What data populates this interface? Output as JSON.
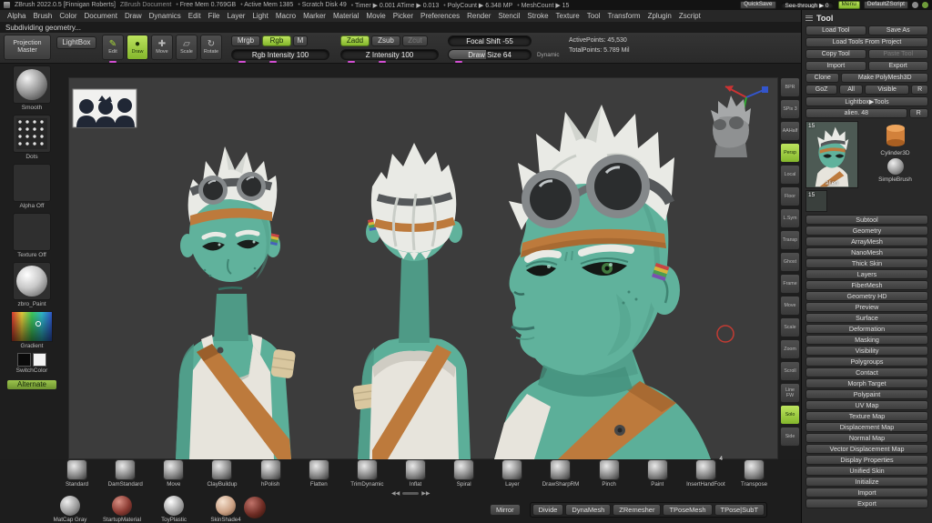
{
  "colors": {
    "accent_green": "#a6d83c",
    "skin_teal": "#60b29c",
    "hair_white": "#e9eae5",
    "strap_orange": "#bd7a3c",
    "canvas_gray": "#3c3c3c"
  },
  "title_bar": {
    "app_title": "ZBrush 2022.0.5 [Finnigan Roberts]",
    "doc_title": "ZBrush Document",
    "stats": [
      "Free Mem 0.769GB",
      "Active Mem 1385",
      "Scratch Disk 49",
      "Timer ▶ 0.001 ATime ▶ 0.013",
      "PolyCount ▶ 6.348 MP",
      "MeshCount ▶ 15"
    ],
    "quicksave": "QuickSave",
    "see_through": "See-through ▶ 0",
    "menu_button": "Menu",
    "zscript_button": "DefaultZScript"
  },
  "menubar": {
    "items": [
      "Alpha",
      "Brush",
      "Color",
      "Document",
      "Draw",
      "Dynamics",
      "Edit",
      "File",
      "Layer",
      "Light",
      "Macro",
      "Marker",
      "Material",
      "Movie",
      "Picker",
      "Preferences",
      "Render",
      "Stencil",
      "Stroke",
      "Texture",
      "Tool",
      "Transform",
      "Zplugin",
      "Zscript"
    ]
  },
  "status": {
    "message": "Subdividing geometry..."
  },
  "top_shelf": {
    "projection_master": "Projection Master",
    "lightbox": "LightBox",
    "edit": "Edit",
    "draw": "Draw",
    "move": "Move",
    "scale": "Scale",
    "rotate": "Rotate",
    "mrgb": "Mrgb",
    "rgb": "Rgb",
    "m": "M",
    "rgb_intensity": "Rgb Intensity 100",
    "zadd": "Zadd",
    "zsub": "Zsub",
    "zcut": "Zcut",
    "z_intensity": "Z Intensity 100",
    "focal_shift": "Focal Shift -55",
    "draw_size": "Draw Size 64",
    "dynamic": "Dynamic",
    "active_points": "ActivePoints: 45,530",
    "total_points": "TotalPoints: 5.789 Mil"
  },
  "left_sidebar": {
    "smooth": "Smooth",
    "dots": "Dots",
    "alpha_off": "Alpha Off",
    "texture_off": "Texture Off",
    "zbro_paint": "zbro_Paint",
    "gradient": "Gradient",
    "switch_color": "SwitchColor",
    "alternate": "Alternate"
  },
  "right_shelf": {
    "items": [
      {
        "label": "BPR"
      },
      {
        "label": "SPix 3"
      },
      {
        "label": "AAHalf"
      },
      {
        "label": "Persp",
        "active": true
      },
      {
        "label": "Local"
      },
      {
        "label": "Floor"
      },
      {
        "label": "L.Sym"
      },
      {
        "label": "Transp"
      },
      {
        "label": "Ghost"
      },
      {
        "label": "Frame"
      },
      {
        "label": "Move"
      },
      {
        "label": "Scale"
      },
      {
        "label": "Zoom"
      },
      {
        "label": "Scroll"
      },
      {
        "label": "Line FW"
      },
      {
        "label": "Solo",
        "active": true
      },
      {
        "label": "Side"
      }
    ]
  },
  "tool_panel": {
    "title": "Tool",
    "load_tool": "Load Tool",
    "save_as": "Save As",
    "load_from_project": "Load Tools From Project",
    "copy_tool": "Copy Tool",
    "paste_tool": "Paste Tool",
    "import": "Import",
    "export": "Export",
    "clone": "Clone",
    "make_polymesh": "Make PolyMesh3D",
    "goz": "GoZ",
    "all": "All",
    "visible": "Visible",
    "r": "R",
    "lightbox_tools": "Lightbox▶Tools",
    "active_tool": "alien. 48",
    "r2": "R",
    "thumb_badge": "15",
    "thumb_label": "alien",
    "thumb2_badge": "15",
    "cylinder": "Cylinder3D",
    "simplebrush": "SimpleBrush",
    "sections": [
      "Subtool",
      "Geometry",
      "ArrayMesh",
      "NanoMesh",
      "Thick Skin",
      "Layers",
      "FiberMesh",
      "Geometry HD",
      "Preview",
      "Surface",
      "Deformation",
      "Masking",
      "Visibility",
      "Polygroups",
      "Contact",
      "Morph Target",
      "Polypaint",
      "UV Map",
      "Texture Map",
      "Displacement Map",
      "Normal Map",
      "Vector Displacement Map",
      "Display Properties",
      "Unified Skin",
      "Initialize",
      "Import",
      "Export"
    ]
  },
  "brush_shelf": {
    "items": [
      {
        "label": "Standard"
      },
      {
        "label": "DamStandard"
      },
      {
        "label": "Move"
      },
      {
        "label": "ClayBuildup"
      },
      {
        "label": "hPolish"
      },
      {
        "label": "Flatten"
      },
      {
        "label": "TrimDynamic"
      },
      {
        "label": "Inflat"
      },
      {
        "label": "Spiral"
      },
      {
        "label": "Layer"
      },
      {
        "label": "DrawSharpRM"
      },
      {
        "label": "Pinch"
      },
      {
        "label": "Paint"
      },
      {
        "label": "InsertHandFoot",
        "badge": "4"
      },
      {
        "label": "Transpose"
      }
    ]
  },
  "material_shelf": {
    "items": [
      {
        "label": "MatCap Gray",
        "kind": "m-gray"
      },
      {
        "label": "StartupMaterial",
        "kind": "m-red"
      },
      {
        "label": "ToyPlastic",
        "kind": "m-plastic"
      },
      {
        "label": "SkinShade4",
        "kind": "m-skin"
      }
    ]
  },
  "bottom_actions": {
    "mirror": "Mirror",
    "divide": "Divide",
    "dynamesh": "DynaMesh",
    "zremesher": "ZRemesher",
    "tposemesh": "TPoseMesh",
    "tpose_subt": "TPose|SubT"
  },
  "canvas": {
    "pager_left": "◀◀",
    "pager_right": "▶▶"
  }
}
